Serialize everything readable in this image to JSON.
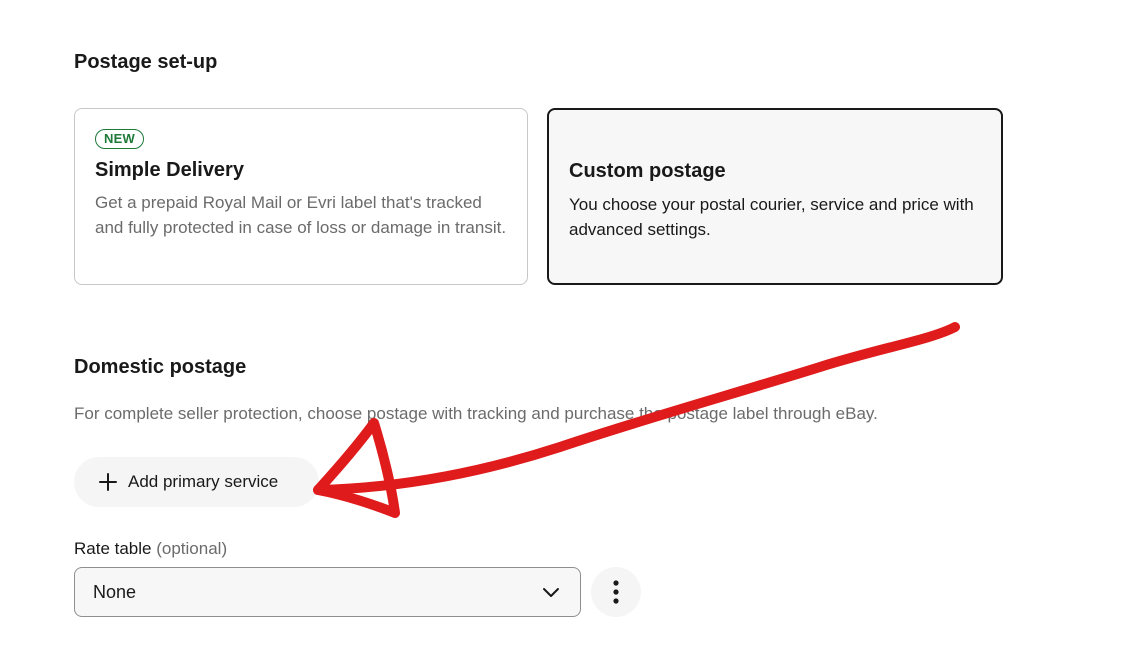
{
  "postage_setup": {
    "heading": "Postage set-up",
    "options": {
      "simple": {
        "badge": "NEW",
        "title": "Simple Delivery",
        "description": "Get a prepaid Royal Mail or Evri label that's tracked and fully protected in case of loss or damage in transit."
      },
      "custom": {
        "title": "Custom postage",
        "description": "You choose your postal courier, service and price with advanced settings.",
        "selected": true
      }
    }
  },
  "domestic_postage": {
    "heading": "Domestic postage",
    "subtext": "For complete seller protection, choose postage with tracking and purchase the postage label through eBay.",
    "add_service_label": "Add primary service",
    "rate_table": {
      "label": "Rate table",
      "optional": "(optional)",
      "value": "None"
    }
  },
  "icons": {
    "add": "plus-icon",
    "select": "chevron-down-icon",
    "more": "more-vertical-icon"
  },
  "colors": {
    "new_badge": "#1f7a3a",
    "annotation_arrow": "#e01b1b",
    "selected_border": "#191919"
  }
}
